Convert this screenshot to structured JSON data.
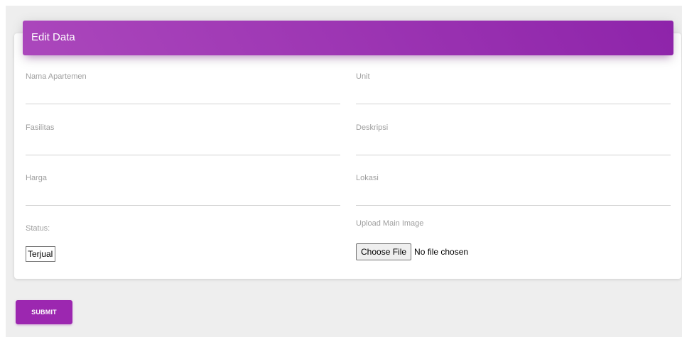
{
  "card": {
    "title": "Edit Data"
  },
  "form": {
    "nama_apartemen": {
      "label": "Nama Apartemen",
      "value": ""
    },
    "unit": {
      "label": "Unit",
      "value": ""
    },
    "fasilitas": {
      "label": "Fasilitas",
      "value": ""
    },
    "deskripsi": {
      "label": "Deskripsi",
      "value": ""
    },
    "harga": {
      "label": "Harga",
      "value": ""
    },
    "lokasi": {
      "label": "Lokasi",
      "value": ""
    },
    "status": {
      "label": "Status:",
      "selected": "Terjual"
    },
    "upload": {
      "label": "Upload Main Image",
      "button_label": "Choose File",
      "status_text": "No file chosen"
    }
  },
  "submit": {
    "label": "SUBMIT"
  },
  "colors": {
    "accent": "#9c27b0",
    "header_gradient_start": "#ab47bc",
    "header_gradient_end": "#8e24aa",
    "background": "#eeeeee"
  }
}
